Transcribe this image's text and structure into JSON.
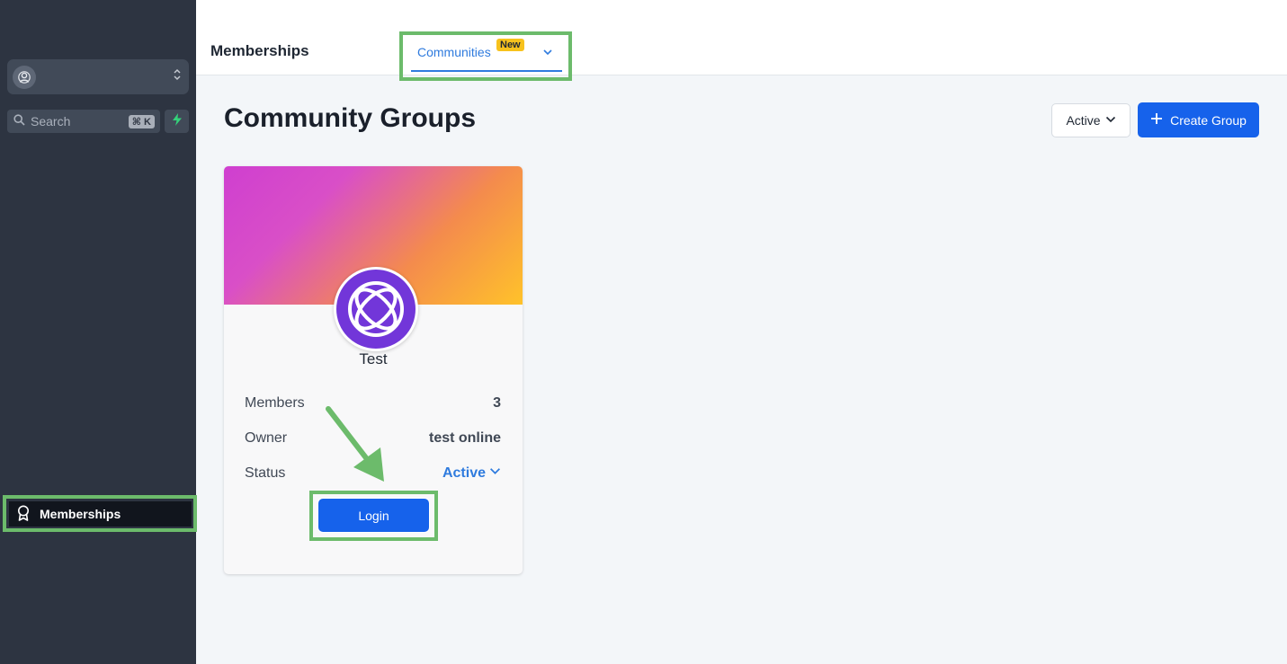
{
  "sidebar": {
    "search": {
      "placeholder": "Search",
      "shortcut": "⌘ K"
    },
    "nav": [
      {
        "label": "Memberships",
        "icon": "award-icon",
        "active": true
      }
    ]
  },
  "header": {
    "title": "Memberships",
    "tab": {
      "label": "Communities",
      "badge": "New"
    }
  },
  "main": {
    "title": "Community Groups",
    "filter_label": "Active",
    "create_label": "Create Group"
  },
  "card": {
    "name": "Test",
    "members_label": "Members",
    "members_value": "3",
    "owner_label": "Owner",
    "owner_value": "test online",
    "status_label": "Status",
    "status_value": "Active",
    "login_label": "Login"
  },
  "colors": {
    "accent": "#1662eb",
    "link": "#2f7bde",
    "sidebar_bg": "#2d3441",
    "highlight": "#6cbb6b",
    "badge": "#f7c21d",
    "logo_bg": "#7236d9"
  }
}
